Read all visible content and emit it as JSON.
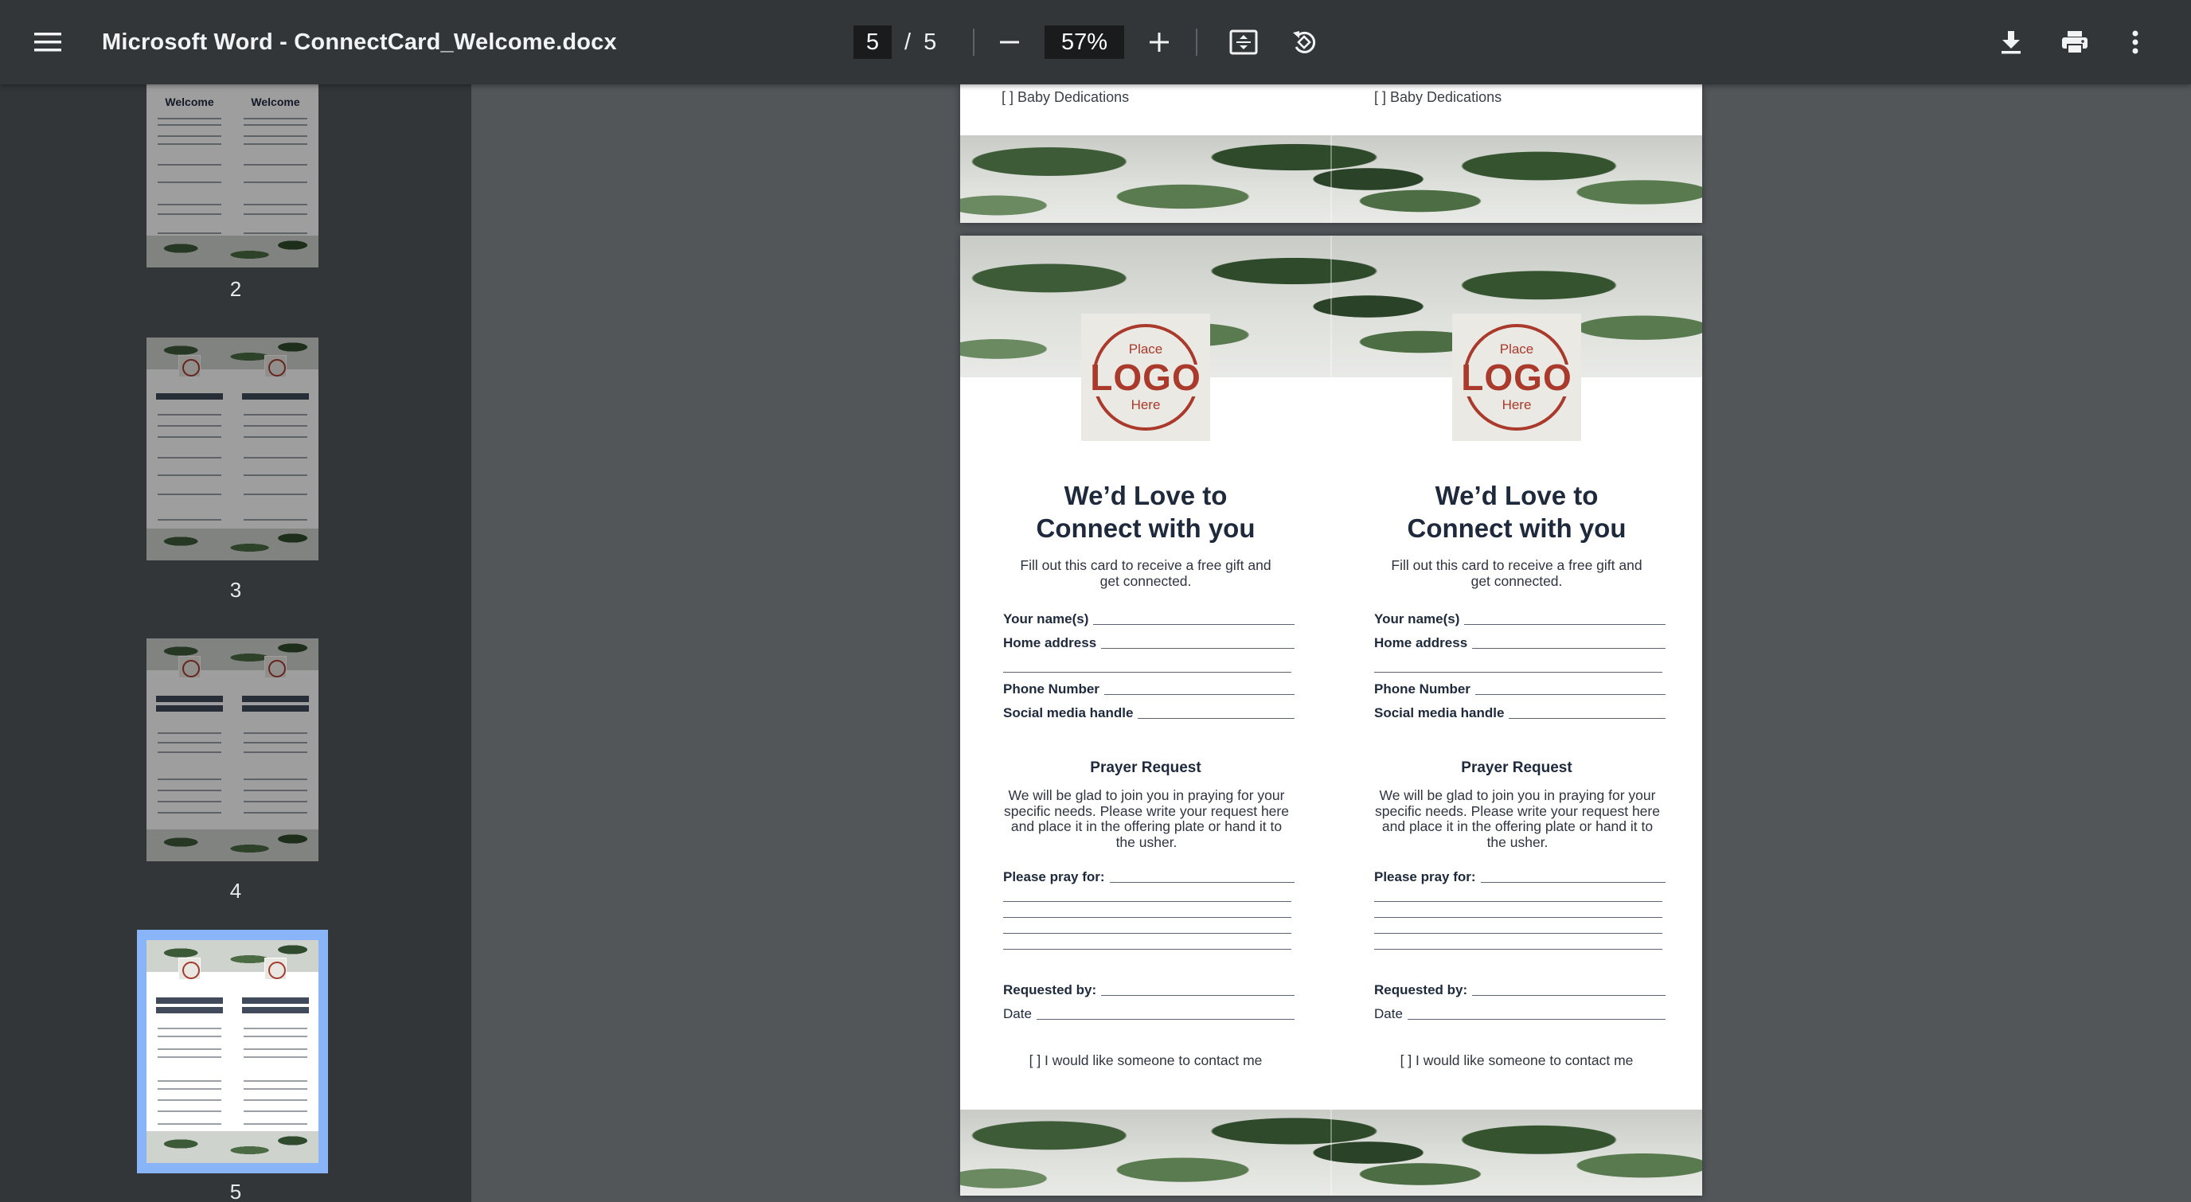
{
  "toolbar": {
    "title": "Microsoft Word - ConnectCard_Welcome.docx",
    "current_page": "5",
    "page_separator": "/",
    "total_pages": "5",
    "zoom": "57%"
  },
  "sidebar": {
    "thumbnails": [
      {
        "label": "2",
        "heading": "Welcome"
      },
      {
        "label": "3"
      },
      {
        "label": "4"
      },
      {
        "label": "5"
      }
    ]
  },
  "prev_page": {
    "left_item": "[  ] Baby Dedications",
    "right_item": "[  ] Baby Dedications"
  },
  "card": {
    "logo_top": "Place",
    "logo_main": "LOGO",
    "logo_bottom": "Here",
    "title_line1": "We’d Love to",
    "title_line2": "Connect with you",
    "subtitle": "Fill out this card to receive a free gift and get connected.",
    "fields": {
      "name": "Your name(s)",
      "address": "Home  address",
      "phone": "Phone Number",
      "social": "Social media handle"
    },
    "prayer_title": "Prayer Request",
    "prayer_text": "We will be glad to join you in praying for your specific needs. Please write your request here and place it in the offering plate or hand it to the usher.",
    "pray_for": "Please pray for:",
    "requested_by": "Requested by:",
    "date": "Date",
    "contact": "[  ] I would like someone to contact me"
  }
}
